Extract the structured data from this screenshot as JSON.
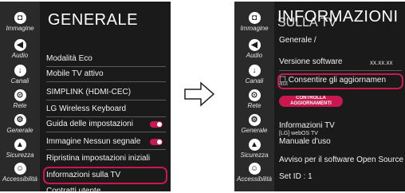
{
  "colors": {
    "accent": "#c8184f",
    "screen_bg": "#1a1a1a",
    "sidebar_bg": "#2a2a2a",
    "text": "#ffffff"
  },
  "sidebar": {
    "items": [
      {
        "label": "Immagine",
        "icon": "image-icon"
      },
      {
        "label": "Audio",
        "icon": "audio-icon"
      },
      {
        "label": "Canali",
        "icon": "channels-icon"
      },
      {
        "label": "Rete",
        "icon": "network-icon"
      },
      {
        "label": "Generale",
        "icon": "general-icon"
      },
      {
        "label": "Sicurezza",
        "icon": "security-icon"
      },
      {
        "label": "Accessibilità",
        "icon": "accessibility-icon"
      }
    ]
  },
  "left_screen": {
    "title": "GENERALE",
    "items": [
      {
        "label": "Modalità Eco"
      },
      {
        "label": "Mobile TV attivo"
      },
      {
        "label": "SIMPLINK (HDMI-CEC)"
      },
      {
        "label": "LG Wireless Keyboard"
      },
      {
        "label": "Guida delle impostazioni",
        "toggle": "on"
      },
      {
        "label": "Immagine Nessun segnale",
        "toggle": "on"
      },
      {
        "label": "Ripristina impostazioni iniziali"
      },
      {
        "label": "Informazioni sulla TV",
        "highlighted": true
      },
      {
        "label": "Contratti utente"
      }
    ]
  },
  "right_screen": {
    "title": "INFORMAZIONI",
    "title_overlap": "SULLA TV",
    "breadcrumb": "Generale /",
    "software_label": "Versione software",
    "software_value": "xx.xx.xx",
    "auto_update_overlap": "aut",
    "auto_update_label": "Consentire gli aggiornamen",
    "check_update_button": "CONTROLLA AGGIORNAMENTI",
    "tv_info_label": "Informazioni TV",
    "tv_info_sub": "[LG] webOS TV",
    "manual_label": "Manuale d'uso",
    "open_source_label": "Avviso per il software Open Source",
    "set_id_label": "Set ID : 1"
  }
}
